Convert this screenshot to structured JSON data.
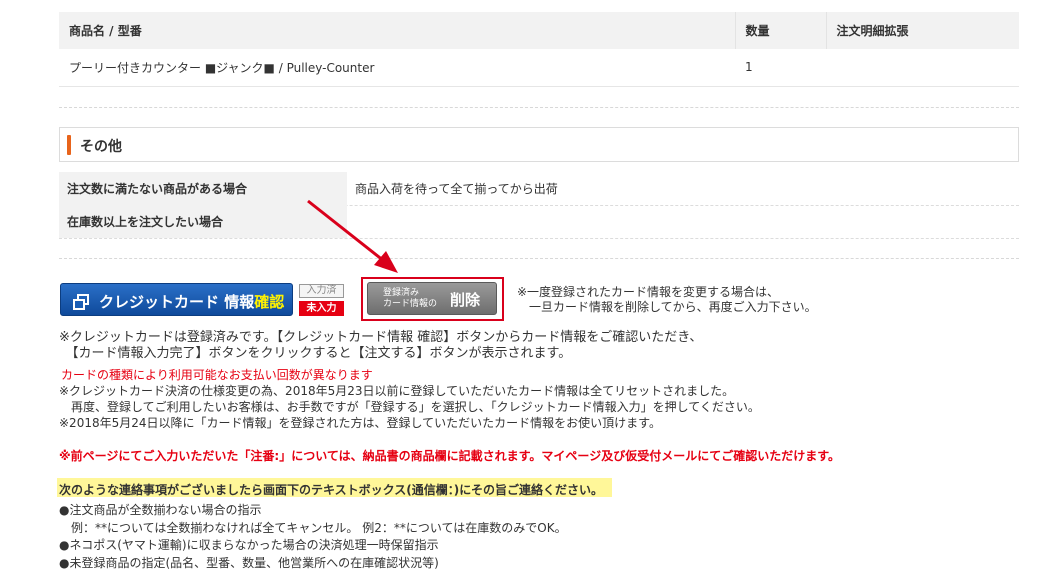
{
  "order_table": {
    "headers": [
      "商品名 / 型番",
      "数量",
      "注文明細拡張"
    ],
    "rows": [
      [
        "プーリー付きカウンター ■ジャンク■ / Pulley-Counter",
        "1",
        ""
      ]
    ]
  },
  "section": {
    "title": "その他"
  },
  "other": [
    {
      "label": "注文数に満たない商品がある場合",
      "value": "商品入荷を待って全て揃ってから出荷"
    },
    {
      "label": "在庫数以上を注文したい場合",
      "value": ""
    }
  ],
  "credit": {
    "confirm_button": {
      "prefix": "クレジットカード 情報",
      "accent": "確認"
    },
    "badge_done": "入力済",
    "badge_todo": "未入力",
    "delete_button": {
      "small_line1": "登録済み",
      "small_line2": "カード情報の",
      "main": "削除"
    },
    "note_right_1": "※一度登録されたカード情報を変更する場合は、",
    "note_right_2": "　一旦カード情報を削除してから、再度ご入力下さい。"
  },
  "texts": {
    "registered_1": "※クレジットカードは登録済みです。【クレジットカード情報 確認】ボタンからカード情報をご確認いただき、",
    "registered_2": "　【カード情報入力完了】ボタンをクリックすると【注文する】ボタンが表示されます。",
    "card_types": "カードの種類により利用可能なお支払い回数が異なります",
    "spec_1": "※クレジットカード決済の仕様変更の為、2018年5月23日以前に登録していただいたカード情報は全てリセットされました。",
    "spec_2": "　再度、登録してご利用したいお客様は、お手数ですが「登録する」を選択し、「クレジットカード情報入力」を押してください。",
    "spec_3": "※2018年5月24日以降に「カード情報」を登録された方は、登録していただいたカード情報をお使い頂けます。",
    "notice": "※前ページにてご入力いただいた「注番:」については、納品書の商品欄に記載されます。マイページ及び仮受付メールにてご確認いただけます。",
    "contact_highlight": "次のような連絡事項がございましたら画面下のテキストボックス(通信欄：)にその旨ご連絡ください。",
    "bullet_1": "●注文商品が全数揃わない場合の指示",
    "bullet_1_ex": "　例：**については全数揃わなければ全てキャンセル。 例2：**については在庫数のみでOK。",
    "bullet_2": "●ネコポス(ヤマト運輸)に収まらなかった場合の決済処理一時保留指示",
    "bullet_3": "●未登録商品の指定(品名、型番、数量、他営業所への在庫確認状況等)"
  },
  "colors": {
    "accent_orange": "#e8641b",
    "red": "#e60012",
    "blue_button": "#1a5db5",
    "highlight": "#fff799"
  }
}
